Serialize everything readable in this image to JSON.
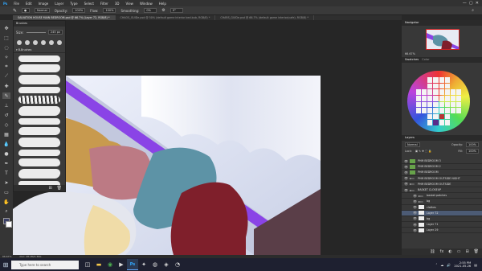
{
  "menu": [
    "File",
    "Edit",
    "Image",
    "Layer",
    "Type",
    "Select",
    "Filter",
    "3D",
    "View",
    "Window",
    "Help"
  ],
  "options": {
    "mode": "Normal",
    "opacity_label": "Opacity:",
    "opacity": "100%",
    "flow_label": "Flow:",
    "flow": "100%",
    "smoothing_label": "Smoothing:",
    "smoothing": "0%",
    "angle": "0°"
  },
  "tabs": [
    {
      "label": "SALVATION HOUSE MAIN BEDROOM.psd @ 66.7% (Layer 72, RGB/8) *",
      "active": true
    },
    {
      "label": "CHAOS_GUIDe.psd @ 50% (default game interior bed.bub, RGB/8) *",
      "active": false
    },
    {
      "label": "CHARS_GUIDe.psd @ 66.7% (default game interior(cafe), RGB/8) *",
      "active": false
    }
  ],
  "brushes": {
    "title": "Brushes",
    "size": "245 px",
    "folder": "B-Brushes",
    "stroke_count": 13
  },
  "navigator": {
    "title": "Navigator",
    "zoom": "66.67%"
  },
  "swatches": {
    "tabs": [
      "Swatches",
      "Color"
    ]
  },
  "layers": {
    "title": "Layers",
    "blend_mode": "Normal",
    "opacity_label": "Opacity:",
    "opacity": "100%",
    "fill_label": "Fill:",
    "fill": "100%",
    "lock_label": "Lock:",
    "rows": [
      {
        "name": "PHM BEDROOM 3",
        "kind": "green",
        "indent": false,
        "selected": false
      },
      {
        "name": "PHM BEDROOM 2",
        "kind": "green",
        "indent": false,
        "selected": false
      },
      {
        "name": "PHM BEDROOM",
        "kind": "green",
        "indent": false,
        "selected": false
      },
      {
        "name": "PHM BEDROOM OUTSIDE NIGHT",
        "kind": "folder",
        "indent": false,
        "selected": false
      },
      {
        "name": "PHM BEDROOM OUTSIDE",
        "kind": "folder",
        "indent": false,
        "selected": false
      },
      {
        "name": "BASKET CLOSEUP",
        "kind": "folder",
        "indent": false,
        "selected": false
      },
      {
        "name": "basket patches",
        "kind": "folder",
        "indent": true,
        "selected": false
      },
      {
        "name": "bg",
        "kind": "folder",
        "indent": true,
        "selected": false
      },
      {
        "name": "clothes",
        "kind": "white",
        "indent": true,
        "selected": false
      },
      {
        "name": "Layer 72",
        "kind": "white",
        "indent": true,
        "selected": true
      },
      {
        "name": "bg",
        "kind": "white",
        "indent": true,
        "selected": false
      },
      {
        "name": "Layer 71",
        "kind": "white",
        "indent": true,
        "selected": false
      },
      {
        "name": "Layer 29",
        "kind": "white",
        "indent": true,
        "selected": false
      }
    ]
  },
  "status": {
    "zoom": "66.67%",
    "doc": "Doc: 28.1M/1.36G"
  },
  "taskbar": {
    "search_placeholder": "Type here to search",
    "time": "2:55 PM",
    "date": "2021-05-26"
  },
  "colors": {
    "ps_blue": "#31a8ff",
    "selected_layer": "#4c5b75",
    "layer_green": "#67a34a",
    "purple_frame": "#8a44e6"
  }
}
